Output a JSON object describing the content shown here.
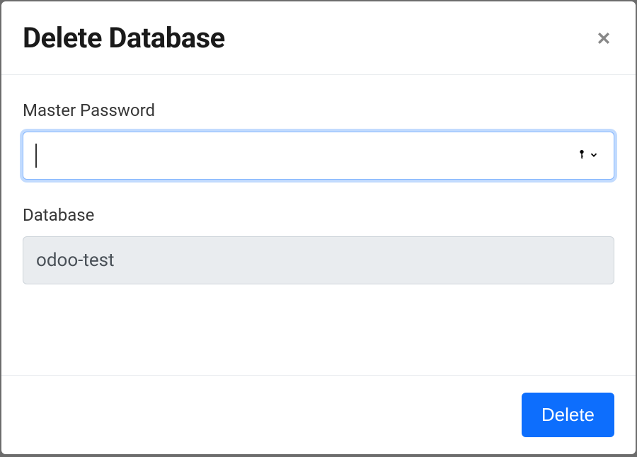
{
  "modal": {
    "title": "Delete Database",
    "fields": {
      "master_password": {
        "label": "Master Password",
        "value": ""
      },
      "database": {
        "label": "Database",
        "value": "odoo-test"
      }
    },
    "actions": {
      "delete_label": "Delete"
    }
  }
}
